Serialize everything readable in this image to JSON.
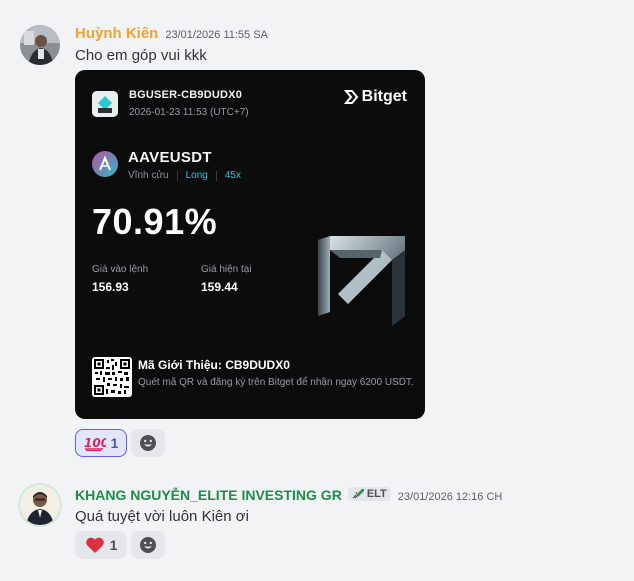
{
  "messages": [
    {
      "author": "Huỳnh Kiên",
      "timestamp": "23/01/2026 11:55 SA",
      "text": "Cho em góp vui kkk",
      "author_color": "#f0a232",
      "card": {
        "uid": "BGUSER-CB9DUDX0",
        "datetime": "2026-01-23 11:53 (UTC+7)",
        "brand": "Bitget",
        "pair": "AAVEUSDT",
        "contract_type": "Vĩnh cửu",
        "side": "Long",
        "leverage": "45x",
        "pnl_percent": "70.91%",
        "entry_label": "Giá vào lệnh",
        "entry_value": "156.93",
        "current_label": "Giá hiện tại",
        "current_value": "159.44",
        "referral_title": "Mã Giới Thiệu: CB9DUDX0",
        "referral_desc": "Quét mã QR và đăng ký trên Bitget để nhận ngay 6200 USDT."
      },
      "reactions": [
        {
          "emoji": "💯",
          "count": "1",
          "active": true
        }
      ]
    },
    {
      "author": "KHANG NGUYỄN_ELITE INVESTING GR",
      "author_color": "#1f8b4c",
      "badge": "ELT",
      "timestamp": "23/01/2026 12:16 CH",
      "text": "Quá tuyệt vời luôn Kiên ơi",
      "reactions": [
        {
          "emoji": "❤️",
          "count": "1",
          "active": false
        }
      ]
    }
  ],
  "colors": {
    "background": "#f2f3f5",
    "card_background": "#0c0c0d",
    "accent_cyan": "#1fc7d4",
    "reaction_active_border": "#5865f2",
    "heart": "#e0245e"
  }
}
